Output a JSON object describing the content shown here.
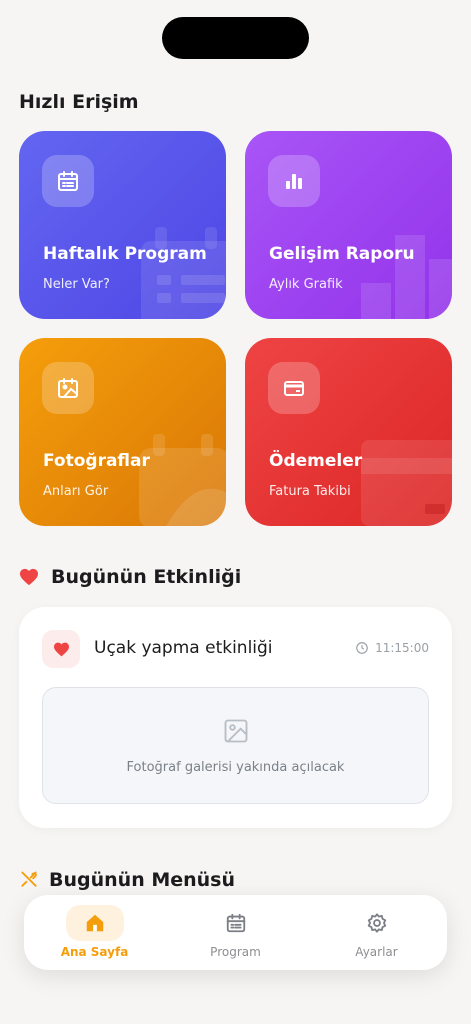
{
  "quick_access": {
    "title": "Hızlı Erişim",
    "cards": [
      {
        "title": "Haftalık Program",
        "subtitle": "Neler Var?",
        "icon": "calendar-icon",
        "color": "#5b5bf0"
      },
      {
        "title": "Gelişim Raporu",
        "subtitle": "Aylık Grafik",
        "icon": "bar-chart-icon",
        "color": "#a14cf0"
      },
      {
        "title": "Fotoğraflar",
        "subtitle": "Anları Gör",
        "icon": "photo-icon",
        "color": "#ef9a0b"
      },
      {
        "title": "Ödemeler",
        "subtitle": "Fatura Takibi",
        "icon": "credit-card-icon",
        "color": "#e53535"
      }
    ]
  },
  "today_activity": {
    "title": "Bugünün Etkinliği",
    "activity_name": "Uçak yapma etkinliği",
    "time": "11:15:00",
    "gallery_text": "Fotoğraf galerisi yakında açılacak"
  },
  "today_menu": {
    "title": "Bugünün Menüsü"
  },
  "tabbar": {
    "tabs": [
      {
        "label": "Ana Sayfa",
        "icon": "home-icon",
        "active": true
      },
      {
        "label": "Program",
        "icon": "calendar-icon",
        "active": false
      },
      {
        "label": "Ayarlar",
        "icon": "gear-icon",
        "active": false
      }
    ]
  },
  "colors": {
    "accent": "#f59e0b",
    "heart": "#ef4444",
    "background": "#f6f5f3"
  }
}
